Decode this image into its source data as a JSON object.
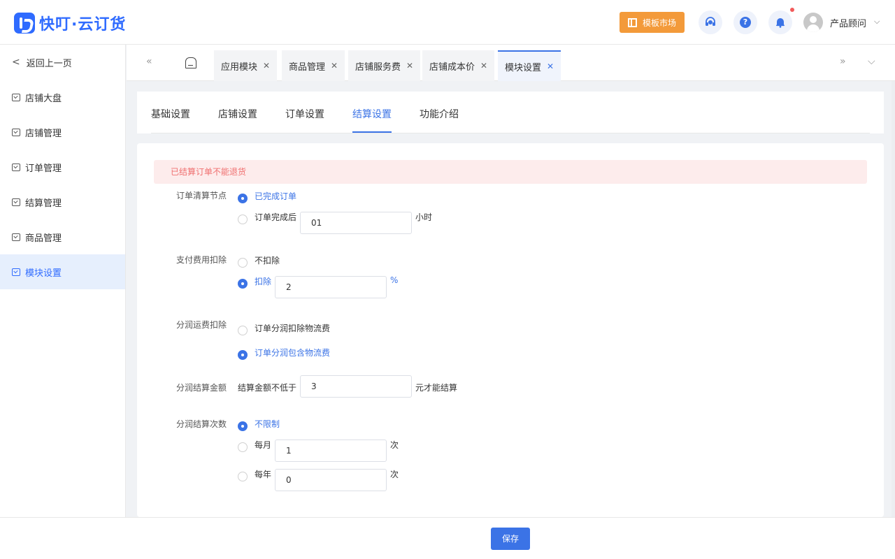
{
  "app": {
    "logo_text": "快叮·云订货"
  },
  "header": {
    "template_market": "模板市场",
    "help_glyph": "?",
    "user_name": "产品顾问",
    "user_chevron": "⌵",
    "icons": [
      "headset-icon",
      "help-icon",
      "bell-icon",
      "avatar"
    ]
  },
  "sidebar": {
    "back": "返回上一页",
    "back_arrow": "<",
    "items": [
      {
        "label": "店铺大盘"
      },
      {
        "label": "店铺管理"
      },
      {
        "label": "订单管理"
      },
      {
        "label": "结算管理"
      },
      {
        "label": "商品管理"
      },
      {
        "label": "模块设置",
        "active": true
      }
    ]
  },
  "tabbar": {
    "prev": "«",
    "next": "»",
    "menu": "⌵",
    "close_glyph": "✕",
    "tabs": [
      {
        "label": "应用模块"
      },
      {
        "label": "商品管理"
      },
      {
        "label": "店铺服务费"
      },
      {
        "label": "店铺成本价"
      },
      {
        "label": "模块设置",
        "active": true
      }
    ]
  },
  "subtabs": {
    "items": [
      {
        "label": "基础设置"
      },
      {
        "label": "店铺设置"
      },
      {
        "label": "订单设置"
      },
      {
        "label": "结算设置",
        "active": true
      },
      {
        "label": "功能介绍"
      }
    ]
  },
  "form": {
    "alert": "已结算订单不能退货",
    "clearing_node": {
      "label": "订单清算节点",
      "option1": "已完成订单",
      "option2": "订单完成后",
      "hours_value": "01",
      "hours_unit": "小时",
      "selected": 1
    },
    "payment_fee": {
      "label": "支付费用扣除",
      "option1": "不扣除",
      "option2": "扣除",
      "percent_value": "2",
      "percent_unit": "%",
      "selected": 2
    },
    "shipping_deduct": {
      "label": "分润运费扣除",
      "option1": "订单分润扣除物流费",
      "option2": "订单分润包含物流费",
      "selected": 2
    },
    "settle_amount": {
      "label": "分润结算金额",
      "prefix": "结算金额不低于",
      "value": "3",
      "suffix": "元才能结算"
    },
    "settle_count": {
      "label": "分润结算次数",
      "option1": "不限制",
      "option2": "每月",
      "monthly_value": "1",
      "option3": "每年",
      "yearly_value": "0",
      "unit": "次",
      "selected": 1
    }
  },
  "footer": {
    "save": "保存"
  },
  "colors": {
    "primary": "#3b73e6",
    "accent_orange": "#f39a3a",
    "alert_bg": "#fdecec",
    "alert_text": "#f07070"
  }
}
